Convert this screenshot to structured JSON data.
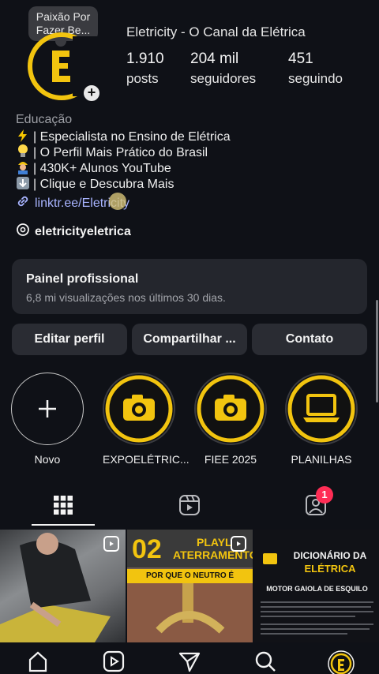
{
  "note": {
    "text_line1": "Paixão Por",
    "text_line2": "Fazer Be..."
  },
  "profile": {
    "name": "Eletricity - O Canal da Elétrica",
    "stats": [
      {
        "value": "1.910",
        "label": "posts"
      },
      {
        "value": "204 mil",
        "label": "seguidores"
      },
      {
        "value": "451",
        "label": "seguindo"
      }
    ],
    "category": "Educação",
    "bio": [
      {
        "icon": "lightning-icon",
        "text": "| Especialista no Ensino de Elétrica"
      },
      {
        "icon": "lightbulb-icon",
        "text": "| O Perfil Mais Prático do Brasil"
      },
      {
        "icon": "worker-icon",
        "text": "| 430K+ Alunos YouTube"
      },
      {
        "icon": "down-arrow-icon",
        "text": "| Clique e Descubra Mais"
      }
    ],
    "link": "linktr.ee/Eletricity",
    "threads_handle": "eletricityeletrica"
  },
  "panel": {
    "title": "Painel profissional",
    "subtitle": "6,8 mi visualizações nos últimos 30 dias."
  },
  "buttons": {
    "edit": "Editar perfil",
    "share": "Compartilhar ...",
    "contact": "Contato"
  },
  "highlights": [
    {
      "label": "Novo",
      "icon": "plus-icon"
    },
    {
      "label": "EXPOELÉTRIC...",
      "icon": "camera-icon"
    },
    {
      "label": "FIEE 2025",
      "icon": "camera-icon"
    },
    {
      "label": "PLANILHAS",
      "icon": "laptop-icon"
    }
  ],
  "tabs": {
    "tagged_badge": "1"
  },
  "posts": {
    "p2_number": "02",
    "p2_title_top": "PLAYL",
    "p2_title_bottom": "ATERRAMENTO",
    "p2_subtitle": "POR QUE O NEUTRO É ATERRADO?",
    "p3_title": "DICIONÁRIO DA",
    "p3_title2": "ELÉTRICA",
    "p3_subtitle": "MOTOR GAIOLA DE ESQUILO"
  },
  "colors": {
    "accent_gold": "#f2c40f",
    "link": "#a8b4ff",
    "badge": "#ff2d55",
    "background": "#0f1117"
  }
}
